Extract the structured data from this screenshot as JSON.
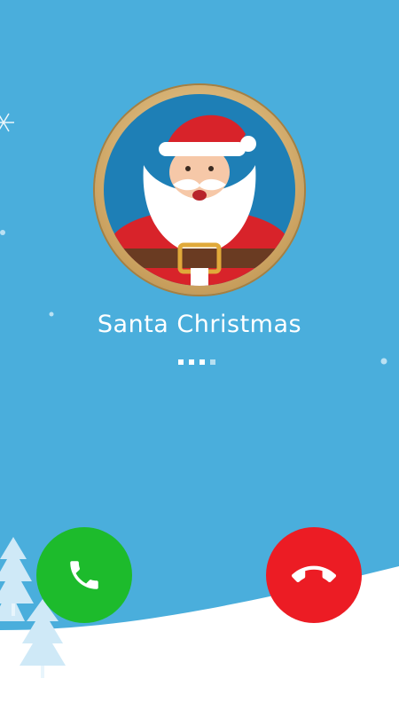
{
  "caller": {
    "name": "Santa Christmas",
    "status_dots": 4
  },
  "buttons": {
    "accept_icon": "phone-icon",
    "decline_icon": "phone-hangup-icon"
  },
  "colors": {
    "background": "#4aaedc",
    "accept": "#1dbb2c",
    "decline": "#ec1c24",
    "frame": "#caa15f"
  }
}
